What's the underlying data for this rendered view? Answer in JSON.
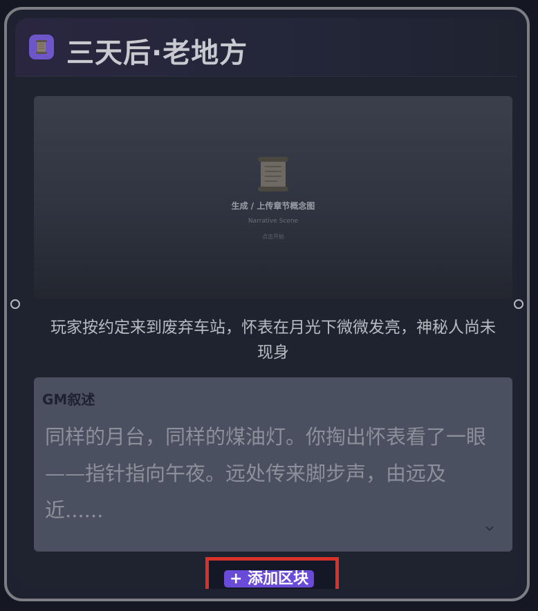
{
  "node": {
    "title": "三天后·老地方",
    "icon": "scroll-icon",
    "accent_color": "#6c56c8"
  },
  "image_placeholder": {
    "icon": "scroll-icon",
    "title": "生成 / 上传章节概念图",
    "subtitle": "Narrative Scene",
    "hint": "点击开始"
  },
  "summary": "玩家按约定来到废弃车站，怀表在月光下微微发亮，神秘人尚未现身",
  "gm_block": {
    "label": "GM叙述",
    "text": "同样的月台，同样的煤油灯。你掏出怀表看了一眼——指针指向午夜。远处传来脚步声，由远及近......",
    "expand_icon": "chevron-down-icon"
  },
  "add_block": {
    "label": "+ 添加区块",
    "button_color": "#6a4bd8",
    "highlight_color": "#d8322a"
  }
}
